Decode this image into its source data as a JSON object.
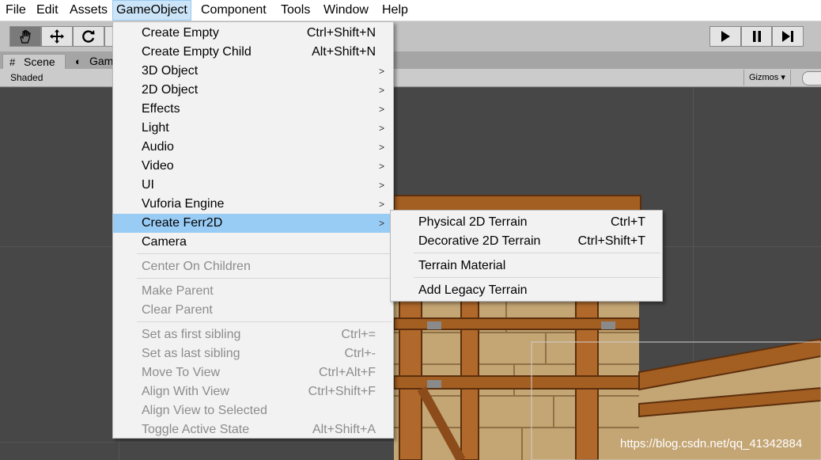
{
  "menubar": {
    "items": [
      "File",
      "Edit",
      "Assets",
      "GameObject",
      "Component",
      "Tools",
      "Window",
      "Help"
    ],
    "active": "GameObject"
  },
  "toolbar": {
    "tools": [
      "hand-icon",
      "move-icon",
      "rotate-icon"
    ],
    "play_controls": [
      "play-icon",
      "pause-icon",
      "step-icon"
    ]
  },
  "tabs": {
    "scene": "Scene",
    "game": "Game"
  },
  "scene_bar": {
    "shading_mode": "Shaded",
    "gizmos": "Gizmos"
  },
  "gameobject_menu": {
    "items": [
      {
        "label": "Create Empty",
        "shortcut": "Ctrl+Shift+N"
      },
      {
        "label": "Create Empty Child",
        "shortcut": "Alt+Shift+N"
      },
      {
        "label": "3D Object",
        "submenu": true
      },
      {
        "label": "2D Object",
        "submenu": true
      },
      {
        "label": "Effects",
        "submenu": true
      },
      {
        "label": "Light",
        "submenu": true
      },
      {
        "label": "Audio",
        "submenu": true
      },
      {
        "label": "Video",
        "submenu": true
      },
      {
        "label": "UI",
        "submenu": true
      },
      {
        "label": "Vuforia Engine",
        "submenu": true
      },
      {
        "label": "Create Ferr2D",
        "submenu": true,
        "highlighted": true
      },
      {
        "label": "Camera"
      },
      {
        "label": "Center On Children",
        "disabled": true
      },
      {
        "label": "Make Parent",
        "disabled": true
      },
      {
        "label": "Clear Parent",
        "disabled": true
      },
      {
        "label": "Set as first sibling",
        "shortcut": "Ctrl+=",
        "disabled": true
      },
      {
        "label": "Set as last sibling",
        "shortcut": "Ctrl+-",
        "disabled": true
      },
      {
        "label": "Move To View",
        "shortcut": "Ctrl+Alt+F",
        "disabled": true
      },
      {
        "label": "Align With View",
        "shortcut": "Ctrl+Shift+F",
        "disabled": true
      },
      {
        "label": "Align View to Selected",
        "disabled": true
      },
      {
        "label": "Toggle Active State",
        "shortcut": "Alt+Shift+A",
        "disabled": true
      }
    ]
  },
  "ferr2d_submenu": {
    "items": [
      {
        "label": "Physical 2D Terrain",
        "shortcut": "Ctrl+T"
      },
      {
        "label": "Decorative 2D Terrain",
        "shortcut": "Ctrl+Shift+T"
      },
      {
        "label": "Terrain Material"
      },
      {
        "label": "Add Legacy Terrain"
      }
    ]
  },
  "watermark": "https://blog.csdn.net/qq_41342884",
  "colors": {
    "menu_highlight": "#99ccf5",
    "menubar_active": "#cce4f7",
    "scene_background": "#474747",
    "disabled_text": "#8c8c8c"
  }
}
